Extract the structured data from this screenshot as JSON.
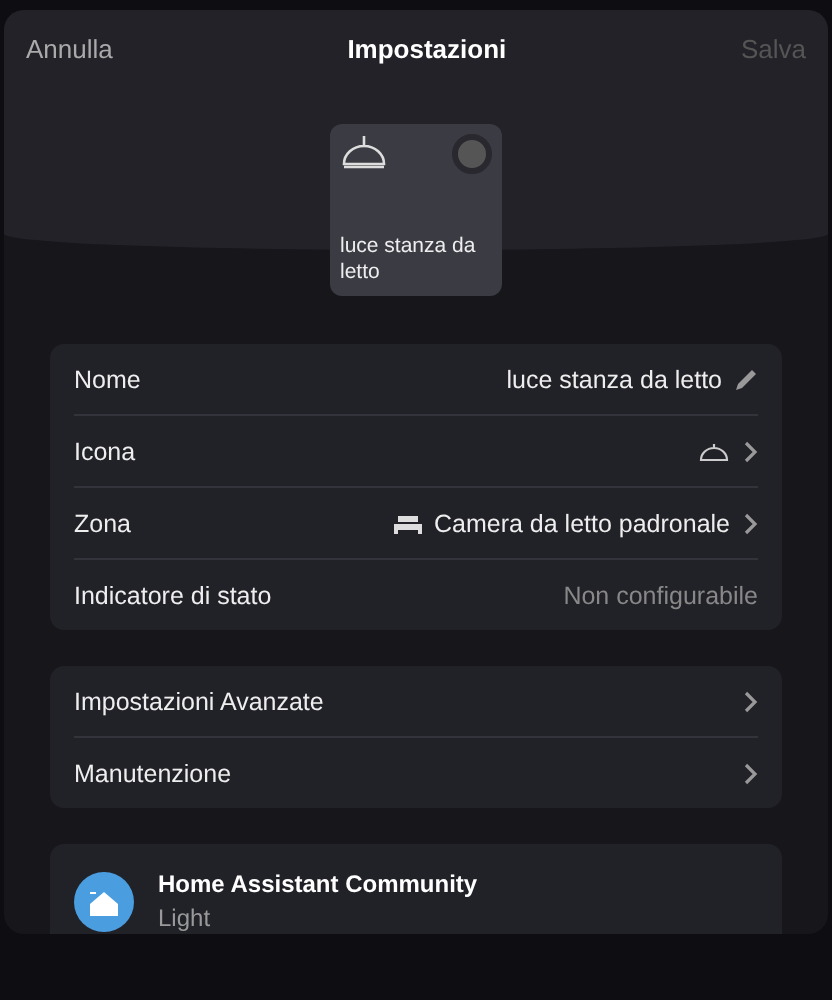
{
  "header": {
    "cancel": "Annulla",
    "title": "Impostazioni",
    "save": {
      "label": "Salva",
      "disabled": true
    }
  },
  "tile": {
    "name": "luce stanza da letto",
    "on": false
  },
  "details": [
    {
      "kind": "edit",
      "label": "Nome",
      "value": "luce stanza da letto"
    },
    {
      "kind": "icon",
      "label": "Icona"
    },
    {
      "kind": "zone",
      "label": "Zona",
      "value": "Camera da letto padronale"
    },
    {
      "kind": "static",
      "label": "Indicatore di stato",
      "value": "Non configurabile"
    }
  ],
  "more": [
    {
      "label": "Impostazioni Avanzate"
    },
    {
      "label": "Manutenzione"
    }
  ],
  "source": {
    "title": "Home Assistant Community",
    "subtitle": "Light"
  }
}
